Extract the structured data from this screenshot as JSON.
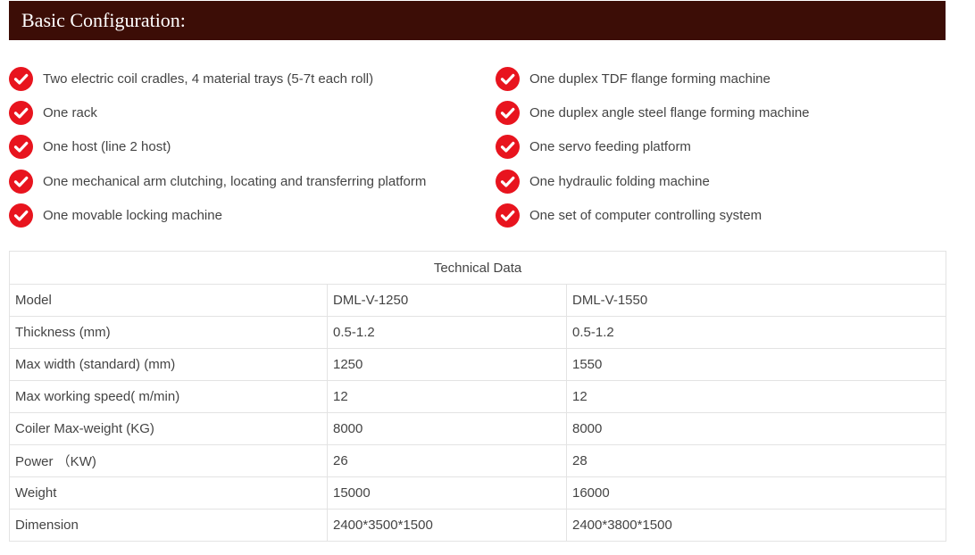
{
  "header": {
    "title": "Basic Configuration:"
  },
  "features": {
    "left": [
      "Two electric coil cradles, 4 material trays (5-7t each roll)",
      "One rack",
      "One host (line 2 host)",
      "One mechanical arm clutching, locating and transferring platform",
      "One movable locking machine"
    ],
    "right": [
      "One duplex TDF flange forming machine",
      "One duplex angle steel flange forming machine",
      "One servo feeding platform",
      "One hydraulic folding machine",
      "One set of computer controlling system"
    ],
    "icon": "check-circle-icon",
    "icon_color": "#e8141e"
  },
  "table": {
    "caption": "Technical Data",
    "rows": [
      [
        "Model",
        "DML-V-1250",
        "DML-V-1550"
      ],
      [
        "Thickness (mm)",
        "0.5-1.2",
        "0.5-1.2"
      ],
      [
        "Max width (standard) (mm)",
        "1250",
        "1550"
      ],
      [
        "Max working speed( m/min)",
        "12",
        "12"
      ],
      [
        "Coiler Max-weight (KG)",
        "8000",
        "8000"
      ],
      [
        "Power （KW)",
        "26",
        "28"
      ],
      [
        "Weight",
        "15000",
        "16000"
      ],
      [
        "Dimension",
        "2400*3500*1500",
        "2400*3800*1500"
      ]
    ]
  },
  "colors": {
    "header_bg": "#3c0d06",
    "accent": "#e8141e"
  }
}
